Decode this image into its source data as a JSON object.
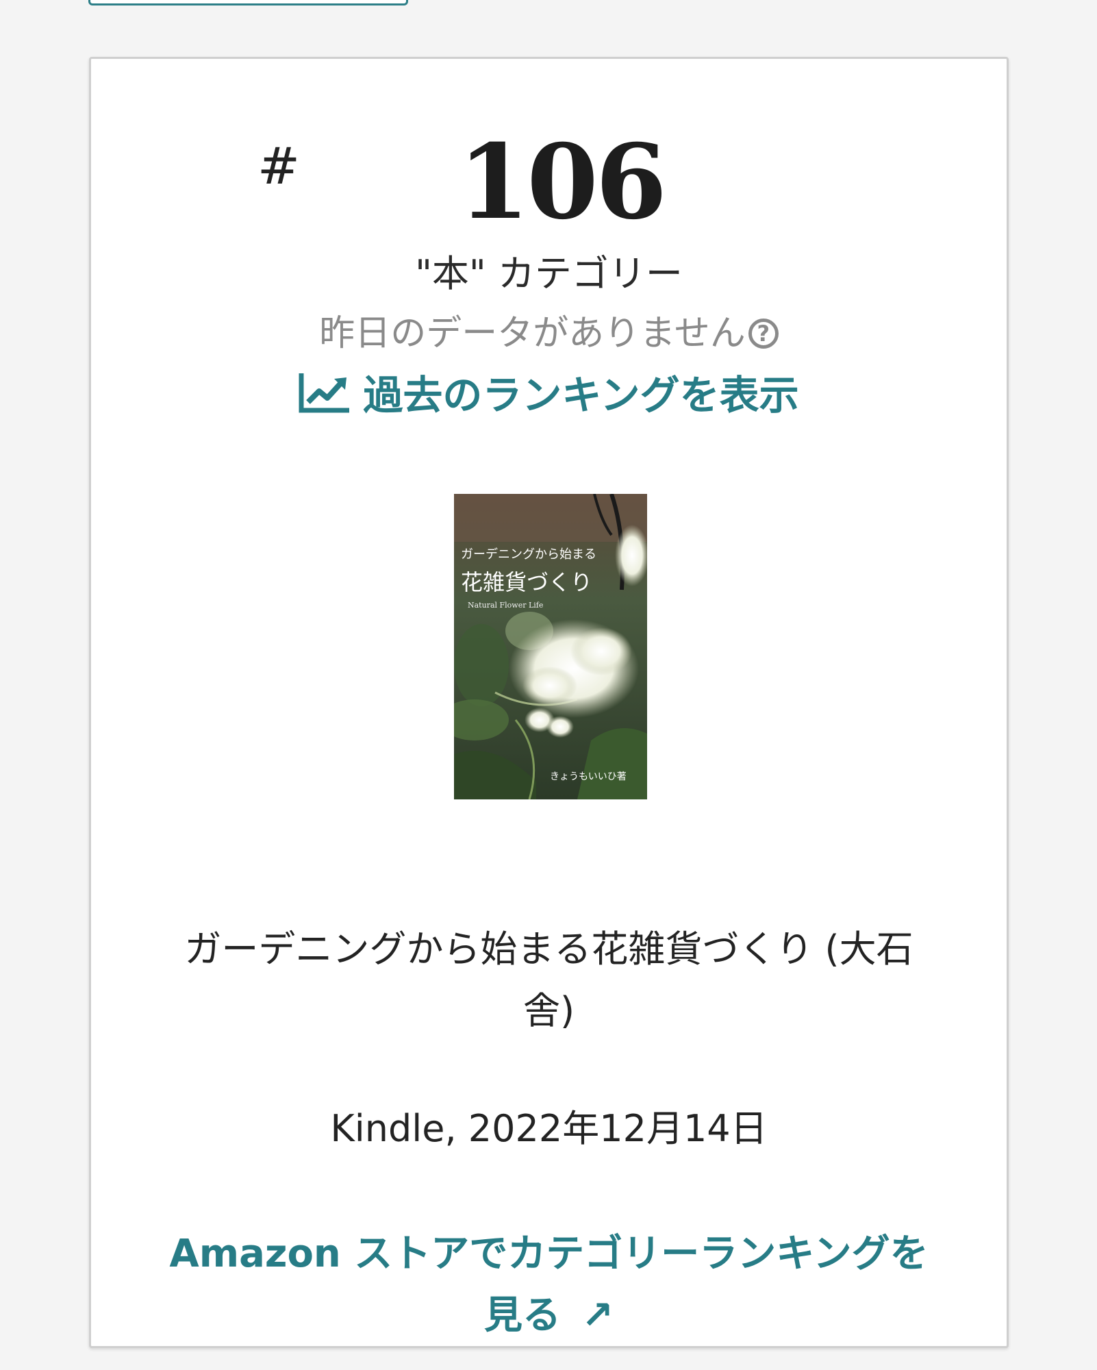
{
  "rank": {
    "hash": "#",
    "number": "106",
    "category": "\"本\" カテゴリー",
    "no_data_text": "昨日のデータがありません",
    "help_icon": "question-circle-icon",
    "history_link": "過去のランキングを表示",
    "history_icon": "trending-chart-icon"
  },
  "book": {
    "cover": {
      "title_small": "ガーデニングから始まる",
      "title_large": "花雑貨づくり",
      "subtitle": "Natural Flower Life",
      "author": "きょうもいいひ著"
    },
    "title": "ガーデニングから始まる花雑貨づくり (大石舎)",
    "edition": "Kindle, 2022年12月14日"
  },
  "store_link": {
    "label": "Amazon ストアでカテゴリーランキングを見る",
    "icon": "external-arrow-icon",
    "arrow": "↗"
  },
  "colors": {
    "link": "#277c86",
    "text": "#232323",
    "muted": "#8a8a8a"
  }
}
